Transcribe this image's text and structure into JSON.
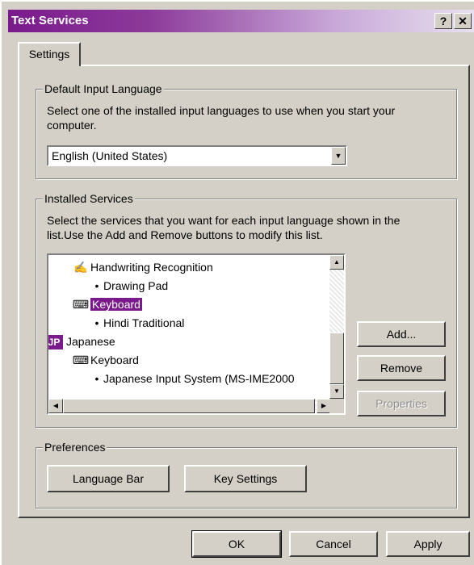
{
  "window": {
    "title": "Text Services",
    "help_button": "?",
    "close_button": "✕"
  },
  "tab": {
    "label": "Settings"
  },
  "default_input_language": {
    "legend": "Default Input Language",
    "description_line1": "Select one of the installed input languages to use when you start your",
    "description_line2": "computer.",
    "selected_value": "English (United States)"
  },
  "installed_services": {
    "legend": "Installed Services",
    "description_line1": "Select the services that you want for each input language shown in the",
    "description_line2": "list.Use the Add and Remove buttons to modify this list.",
    "tree": [
      {
        "label": "Handwriting Recognition",
        "icon": "pen-icon"
      },
      {
        "label": "Drawing Pad",
        "icon": "bullet"
      },
      {
        "label": "Keyboard",
        "icon": "keyboard-icon",
        "selected": true
      },
      {
        "label": "Hindi Traditional",
        "icon": "bullet"
      },
      {
        "label": "Japanese",
        "badge": "JP"
      },
      {
        "label": "Keyboard",
        "icon": "keyboard-icon"
      },
      {
        "label": "Japanese Input System (MS-IME2000",
        "icon": "bullet"
      }
    ],
    "add_button": "Add...",
    "remove_button": "Remove",
    "properties_button": "Properties"
  },
  "preferences": {
    "legend": "Preferences",
    "language_bar_button": "Language Bar",
    "key_settings_button": "Key Settings"
  },
  "footer": {
    "ok_button": "OK",
    "cancel_button": "Cancel",
    "apply_button": "Apply"
  },
  "colors": {
    "title_gradient_start": "#7a1a8c",
    "selection": "#7a1a8c",
    "face": "#d4d0c8"
  }
}
